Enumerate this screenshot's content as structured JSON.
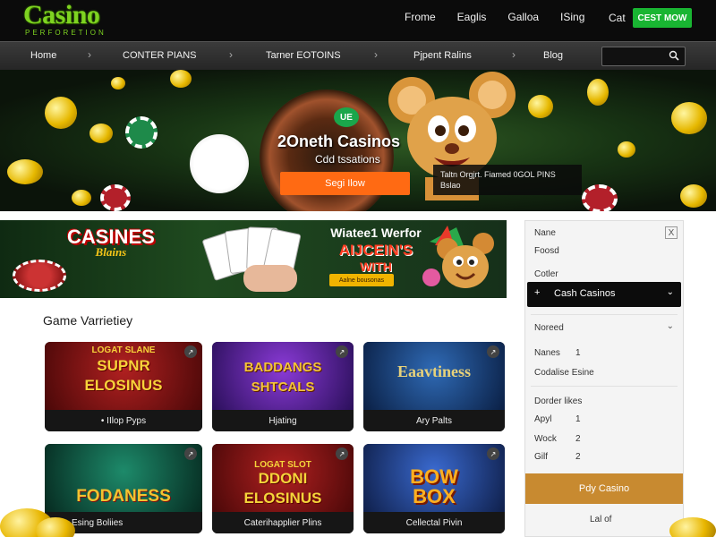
{
  "header": {
    "logo": "Casino",
    "logo_sub": "PERFORETION",
    "nav": [
      "Frome",
      "Eaglis",
      "Galloa",
      "ISing"
    ],
    "cat_link": "Cat",
    "cta": "CEST MOW"
  },
  "navbar": {
    "items": [
      "Home",
      "CONTER PIANS",
      "Tarner EOTOINS",
      "Pjpent Ralins",
      "Blog"
    ],
    "search_placeholder": ""
  },
  "hero": {
    "badge": "UE",
    "title": "2Oneth Casinos",
    "subtitle": "Cdd tssations",
    "button": "Segi Ilow",
    "promo_line1": "Taltn Orgjrt. Fiamed  0GOL PINS",
    "promo_line2": "Bslao"
  },
  "promo_banner": {
    "logo_main": "CASINES",
    "logo_sub": "Blains",
    "line1": "Wiatee1 Werfor",
    "line2": "AIJCEIN'S",
    "line3": "WITH",
    "button": "Aalne bousonas"
  },
  "section": {
    "title": "Game Varrietiey"
  },
  "games": [
    {
      "top": "LOGAT  SLANE",
      "title": "SUPNR\nELOSINUS",
      "caption": "• IIlop Pyps",
      "bg": "#6a0d0d",
      "color": "#f7d23a"
    },
    {
      "top": "",
      "title": "BADDANGS\nSHTCALS",
      "caption": "Hjating",
      "bg": "#3b1a7a",
      "color": "#f3c43a"
    },
    {
      "top": "",
      "title": "Eaavtiness",
      "caption": "Ary Palts",
      "bg": "#0f2a5a",
      "color": "#e8d27a"
    },
    {
      "top": "",
      "title": "FODANESS",
      "caption": "Esing Boliies",
      "bg": "#0c4a3a",
      "color": "#f2c330"
    },
    {
      "top": "LOGAT  SLOT",
      "title": "DDONI\nELOSINUS",
      "caption": "Caterihapplier Plins",
      "bg": "#5a1010",
      "color": "#f5d53a"
    },
    {
      "top": "",
      "title": "BOW\nBOX",
      "caption": "Cellectal Pivin",
      "bg": "#1b3a6a",
      "color": "#ffb020"
    }
  ],
  "sidebar": {
    "close": "X",
    "row1": "Nane",
    "row2": "Foosd",
    "row3": "Cotler",
    "select": "Cash Casinos",
    "select_prefix": "+",
    "section2": "Noreed",
    "r_names": "Nanes",
    "r_names_val": "1",
    "r_codaliez": "Codalise Esine",
    "section3": "Dorder likes",
    "r_apyl": "Apyl",
    "r_apyl_val": "1",
    "r_wock": "Wock",
    "r_wock_val": "2",
    "r_gilf": "Gilf",
    "r_gilf_val": "2",
    "button": "Pdy Casino",
    "footer": "Lal of"
  }
}
